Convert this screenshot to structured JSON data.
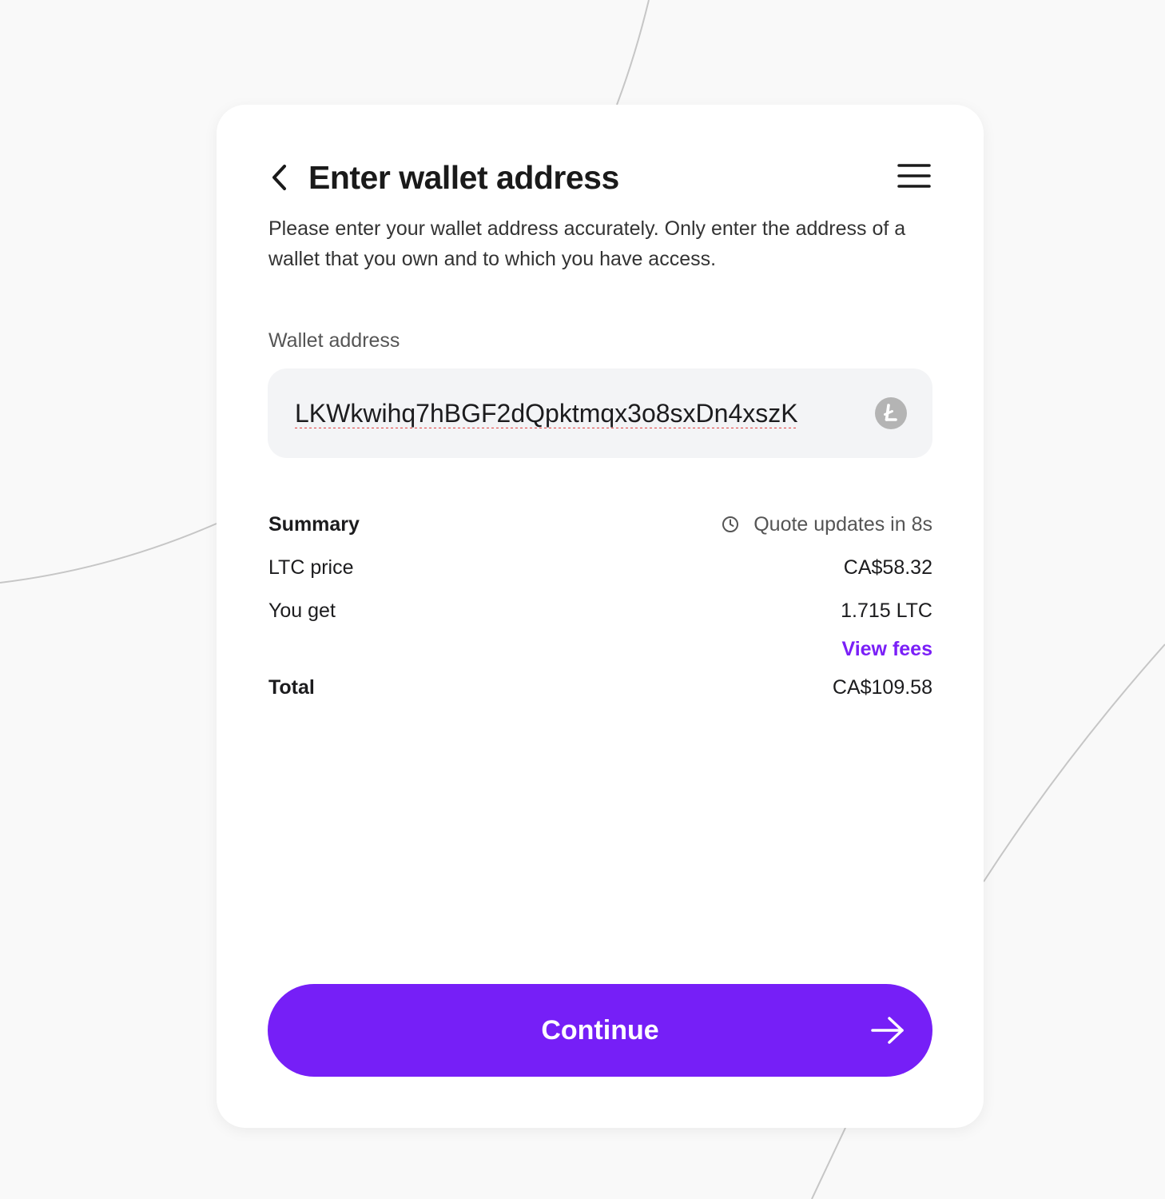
{
  "header": {
    "title": "Enter wallet address",
    "back_icon": "chevron-left-icon",
    "menu_icon": "hamburger-menu-icon"
  },
  "description": "Please enter your wallet address accurately. Only enter the address of a wallet that you own and to which you have access.",
  "wallet": {
    "label": "Wallet address",
    "value": "LKWkwihq7hBGF2dQpktmqx3o8sxDn4xszK",
    "currency_icon": "litecoin-icon",
    "currency_icon_glyph": "Ł"
  },
  "summary": {
    "title": "Summary",
    "quote_text": "Quote updates in 8s",
    "quote_icon": "clock-icon",
    "rows": [
      {
        "label": "LTC price",
        "value": "CA$58.32"
      },
      {
        "label": "You get",
        "value": "1.715 LTC"
      }
    ],
    "fees_link": "View fees",
    "total_label": "Total",
    "total_value": "CA$109.58"
  },
  "continue_button": {
    "label": "Continue",
    "icon": "arrow-right-icon"
  },
  "colors": {
    "accent": "#761ff7",
    "link": "#7a1ff7",
    "background": "#f9f9f9",
    "card": "#ffffff",
    "input_bg": "#f3f4f6"
  }
}
